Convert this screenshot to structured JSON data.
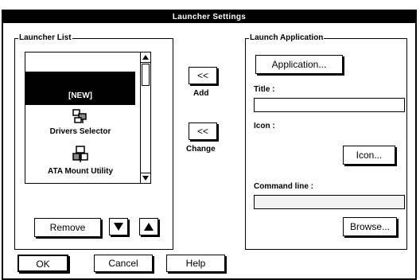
{
  "window": {
    "title": "Launcher Settings"
  },
  "launcher_list": {
    "label": "Launcher List",
    "items": [
      {
        "label": "[NEW]",
        "selected": true
      },
      {
        "label": "Drivers Selector",
        "icon": "drivers-selector-icon"
      },
      {
        "label": "ATA Mount Utility",
        "icon": "ata-mount-utility-icon"
      }
    ],
    "remove_label": "Remove",
    "move_down_icon": "triangle-down-icon",
    "move_up_icon": "triangle-up-icon"
  },
  "middle": {
    "add_button_text": "<<",
    "add_label": "Add",
    "change_button_text": "<<",
    "change_label": "Change"
  },
  "launch_application": {
    "label": "Launch Application",
    "application_button": "Application...",
    "title_label": "Title :",
    "title_value": "",
    "icon_label": "Icon :",
    "icon_button": "Icon...",
    "command_line_label": "Command line :",
    "command_line_value": "",
    "browse_button": "Browse..."
  },
  "footer": {
    "ok_label": "OK",
    "cancel_label": "Cancel",
    "help_label": "Help"
  }
}
